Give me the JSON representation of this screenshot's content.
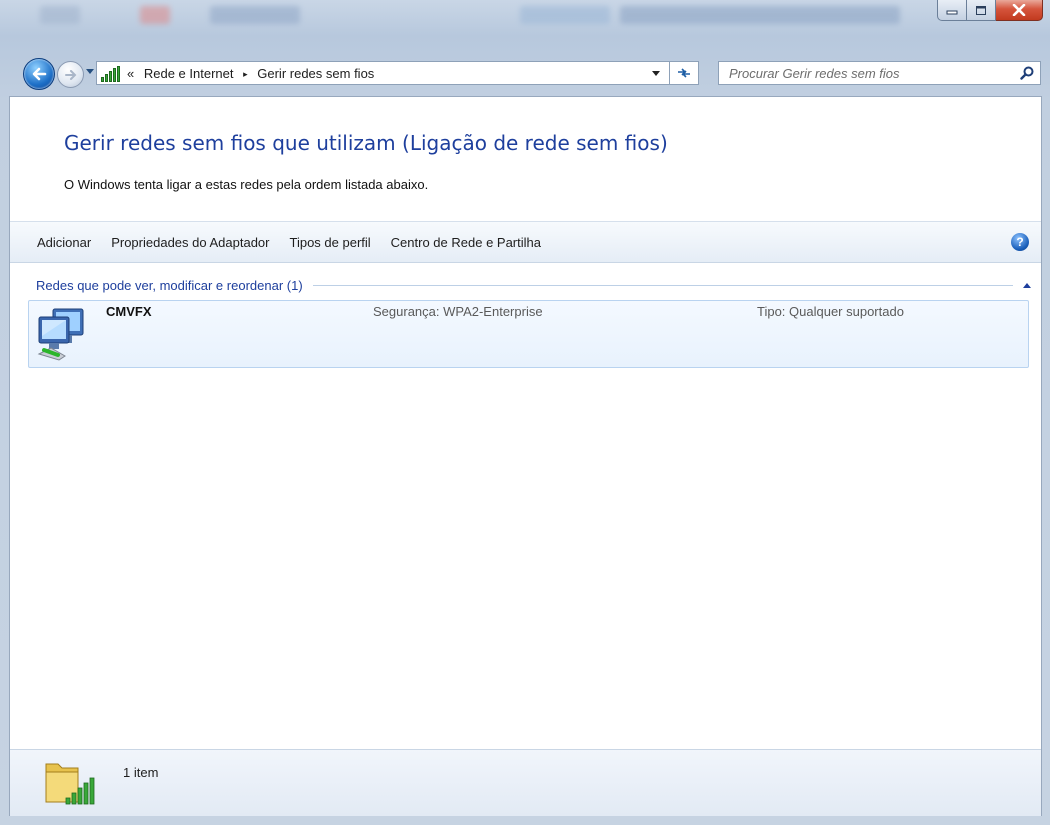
{
  "window": {
    "caption_buttons": {
      "minimize": "minimize",
      "maximize": "maximize",
      "close": "close"
    }
  },
  "addressbar": {
    "overflow": "«",
    "crumbs": [
      "Rede e Internet",
      "Gerir redes sem fios"
    ],
    "separator": "▸"
  },
  "search": {
    "placeholder": "Procurar Gerir redes sem fios"
  },
  "page": {
    "title": "Gerir redes sem fios que utilizam (Ligação de rede sem fios)",
    "subtitle": "O Windows tenta ligar a estas redes pela ordem listada abaixo."
  },
  "commandbar": {
    "items": [
      "Adicionar",
      "Propriedades do Adaptador",
      "Tipos de perfil",
      "Centro de Rede e Partilha"
    ],
    "help": "?"
  },
  "group": {
    "label": "Redes que pode ver, modificar e reordenar (1)"
  },
  "networks": [
    {
      "name": "CMVFX",
      "security": "Segurança: WPA2-Enterprise",
      "type": "Tipo: Qualquer suportado"
    }
  ],
  "status": {
    "count_text": "1 item"
  },
  "colors": {
    "title_blue": "#1e3f9d",
    "link_blue": "#1e3f9d",
    "close_red": "#c23a1f"
  }
}
